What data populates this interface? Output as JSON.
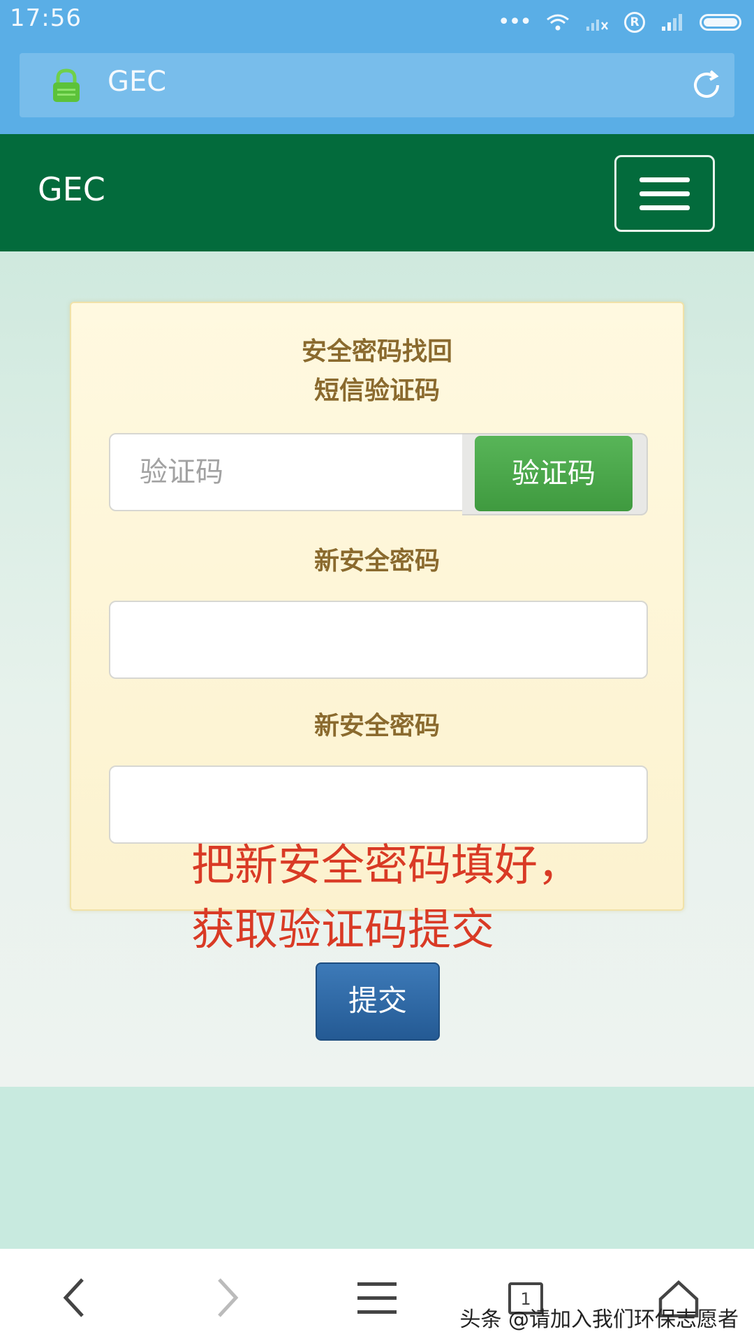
{
  "status_bar": {
    "time": "17:56"
  },
  "browser": {
    "url": "GEC"
  },
  "site": {
    "brand": "GEC"
  },
  "form": {
    "title": "安全密码找回",
    "sms_label": "短信验证码",
    "code_placeholder": "验证码",
    "get_code_button": "验证码",
    "new_password_label": "新安全密码",
    "confirm_password_label": "新安全密码",
    "submit_button": "提交"
  },
  "annotation": {
    "line1": "把新安全密码填好，",
    "line2": "获取验证码提交"
  },
  "bottom_nav": {
    "tabs_count": "1"
  },
  "watermark": "头条 @请加入我们环保志愿者",
  "colors": {
    "header_green": "#036b3c",
    "status_blue": "#5aaee6",
    "code_button_green": "#4aa84a",
    "submit_blue": "#2d6aa6",
    "annotation_red": "#d93a25",
    "label_brown": "#8a6a2e"
  }
}
